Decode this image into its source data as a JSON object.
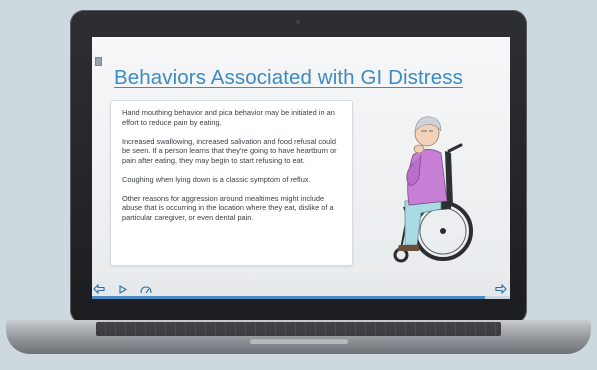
{
  "slide": {
    "title": "Behaviors Associated with GI Distress",
    "paragraphs": [
      "Hand mouthing behavior and pica behavior may be initiated in an effort to reduce pain by eating.",
      "Increased swallowing, increased salivation and food refusal could be seen.  If a person learns that they're going to have heartburn or pain after eating, they may begin to start refusing to eat.",
      "Coughing when lying down is a classic symptom of reflux.",
      "Other reasons for aggression around mealtimes might include abuse that is occurring in the location where they eat, dislike of a particular caregiver, or even dental pain."
    ],
    "illustration_icon": "elderly-woman-in-wheelchair-illustration"
  },
  "player": {
    "progress": 0.94,
    "controls": {
      "prev": "arrow-left-icon",
      "play": "play-icon",
      "speed": "speed-gauge-icon",
      "next": "arrow-right-icon"
    }
  },
  "colors": {
    "title": "#3d8bc0",
    "accent": "#2d6ea3",
    "progress": "#4a8cc3"
  }
}
